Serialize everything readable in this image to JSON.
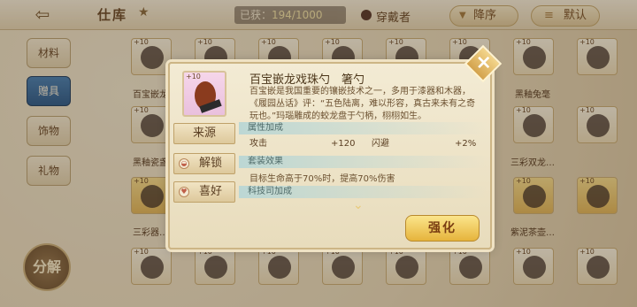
{
  "topbar": {
    "back_icon": "back-arrow-icon",
    "title": "仕库",
    "count_label": "已获：",
    "count_value": "194/1000",
    "wear_label": "穿戴者",
    "sort_label": "降序",
    "default_label": "默认"
  },
  "tabs": [
    "材料",
    "赠具",
    "饰物",
    "礼物"
  ],
  "active_tab": 1,
  "dismantle_label": "分解",
  "grid": {
    "card_lv": "+10",
    "names": [
      "百宝嵌龙",
      "黑釉瓷盏",
      "三彩器…",
      "黑釉兔毫",
      "三彩双龙…",
      "紫泥茶壶…"
    ]
  },
  "modal": {
    "close_icon": "close-x-icon",
    "item_lv": "+10",
    "item_title": "百宝嵌龙戏珠勺　箸勺",
    "item_desc": "百宝嵌是我国重要的镶嵌技术之一，多用于漆器和木器，《履园丛话》评：“五色陆离，难以形容，真古来未有之奇玩也。”玛瑙雕成的蛟龙盘于勺柄，栩栩如生。",
    "side_buttons": {
      "source": "来源",
      "unlock": "解锁",
      "favorite": "喜好"
    },
    "sections": {
      "attr": "属性加成",
      "set": "套装效果",
      "tech": "科技司加成"
    },
    "stats": {
      "atk_label": "攻击",
      "atk_value": "+120",
      "dodge_label": "闪避",
      "dodge_value": "+2%"
    },
    "set_effect_text": "目标生命高于70%时，提高70%伤害",
    "upgrade_label": "强化"
  }
}
